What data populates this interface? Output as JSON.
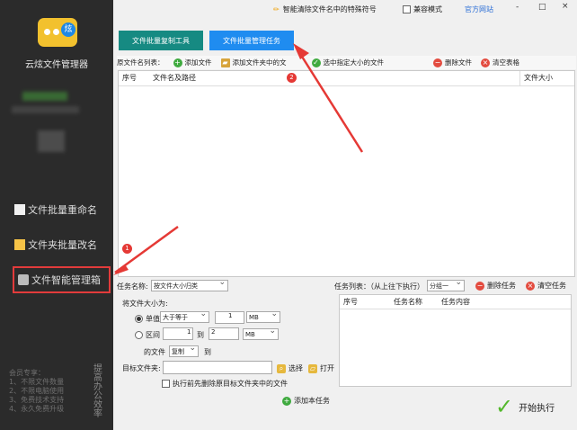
{
  "sidebar": {
    "app_name": "云炫文件管理器",
    "items": [
      {
        "label": "文件批量重命名"
      },
      {
        "label": "文件夹批量改名"
      },
      {
        "label": "文件智能管理箱"
      }
    ],
    "member_lines": [
      "会员专享：",
      "1、不限文件数量",
      "2、不限电脑使用",
      "3、免费技术支持",
      "4、永久免费升级"
    ],
    "vertical_text": "提高办公效率"
  },
  "window": {
    "special_chars_label": "智能清除文件名中的特殊符号",
    "compat_label": "兼容模式",
    "website_label": "官方网站",
    "minimize": "-",
    "maximize": "□",
    "close": "×"
  },
  "top_tabs": {
    "tool1": "文件批量复制工具",
    "tool2": "文件批量管理任务"
  },
  "toolbar": {
    "source_list": "原文件名列表：",
    "add_file": "添加文件",
    "add_folder": "添加文件夹中的文",
    "select_size": "选中指定大小的文件",
    "delete_file": "删除文件",
    "clear_table": "清空表格"
  },
  "file_table": {
    "headers": [
      "序号",
      "文件名及路径",
      "文件大小"
    ]
  },
  "task": {
    "name_label": "任务名称:",
    "name_value": "按文件大小归类",
    "list_label": "任务列表：（从上往下执行）",
    "group_value": "分组一",
    "delete_task": "删除任务",
    "clear_task": "清空任务",
    "headers": [
      "序号",
      "任务名称",
      "任务内容"
    ]
  },
  "form": {
    "size_label": "将文件大小为:",
    "single_label": "单值",
    "compare_value": "大于等于",
    "value1": "1",
    "unit1": "MB",
    "range_label": "区间",
    "range_from": "1",
    "range_to_label": "到",
    "range_to": "2",
    "unit2": "MB",
    "files_label": "的文件",
    "action_value": "复制",
    "to_label": "到",
    "target_label": "目标文件夹:",
    "choose": "选择",
    "open": "打开",
    "delete_before": "执行前先删除原目标文件夹中的文件",
    "add_task": "添加本任务",
    "start": "开始执行"
  },
  "markers": {
    "one": "1",
    "two": "2"
  }
}
